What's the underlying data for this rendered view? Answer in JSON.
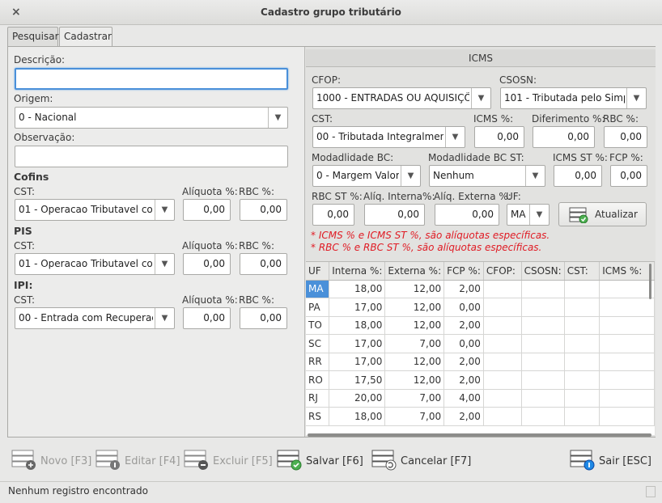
{
  "window": {
    "title": "Cadastro grupo tributário",
    "close_label": "×"
  },
  "tabs": [
    {
      "label": "Pesquisar"
    },
    {
      "label": "Cadastrar"
    }
  ],
  "form": {
    "descricao_label": "Descrição:",
    "descricao_value": "",
    "origem_label": "Origem:",
    "origem_value": "0 - Nacional",
    "observacao_label": "Observação:",
    "observacao_value": "",
    "cofins": {
      "title": "Cofins",
      "cst_label": "CST:",
      "cst_value": "01 - Operacao Tributavel com",
      "aliquota_label": "Alíquota %:",
      "aliquota_value": "0,00",
      "rbc_label": "RBC %:",
      "rbc_value": "0,00"
    },
    "pis": {
      "title": "PIS",
      "cst_label": "CST:",
      "cst_value": "01 - Operacao Tributavel com",
      "aliquota_label": "Alíquota %:",
      "aliquota_value": "0,00",
      "rbc_label": "RBC %:",
      "rbc_value": "0,00"
    },
    "ipi": {
      "title": "IPI:",
      "cst_label": "CST:",
      "cst_value": "00 - Entrada com Recuperaçã",
      "aliquota_label": "Alíquota %:",
      "aliquota_value": "0,00",
      "rbc_label": "RBC %:",
      "rbc_value": "0,00"
    }
  },
  "icms": {
    "title": "ICMS",
    "cfop_label": "CFOP:",
    "cfop_value": "1000 - ENTRADAS OU AQUISIÇÕE",
    "csosn_label": "CSOSN:",
    "csosn_value": "101 - Tributada pelo Simpl",
    "cst_label": "CST:",
    "cst_value": "00 - Tributada Integralmente",
    "icms_label": "ICMS %:",
    "icms_value": "0,00",
    "diferimento_label": "Diferimento %:",
    "diferimento_value": "0,00",
    "rbc_label": "RBC %:",
    "rbc_value": "0,00",
    "modbc_label": "Modadlidade BC:",
    "modbc_value": "0 - Margem Valor",
    "modbcst_label": "Modadlidade BC ST:",
    "modbcst_value": "Nenhum",
    "icmsst_label": "ICMS ST %:",
    "icmsst_value": "0,00",
    "fcp_label": "FCP %:",
    "fcp_value": "0,00",
    "rbcst_label": "RBC ST %:",
    "rbcst_value": "0,00",
    "aliq_interna_label": "Alíq. Interna%:",
    "aliq_interna_value": "0,00",
    "aliq_externa_label": "Alíq. Externa %:",
    "aliq_externa_value": "0,00",
    "uf_label": "UF:",
    "uf_value": "MA",
    "atualizar_label": "Atualizar",
    "note1": "* ICMS % e ICMS ST %, são alíquotas específicas.",
    "note2": "* RBC % e RBC ST %, são alíquotas específicas.",
    "table": {
      "columns": [
        "UF",
        "Interna %:",
        "Externa %:",
        "FCP %:",
        "CFOP:",
        "CSOSN:",
        "CST:",
        "ICMS %:"
      ],
      "rows": [
        [
          "MA",
          "18,00",
          "12,00",
          "2,00",
          "",
          "",
          "",
          ""
        ],
        [
          "PA",
          "17,00",
          "12,00",
          "0,00",
          "",
          "",
          "",
          ""
        ],
        [
          "TO",
          "18,00",
          "12,00",
          "2,00",
          "",
          "",
          "",
          ""
        ],
        [
          "SC",
          "17,00",
          "7,00",
          "0,00",
          "",
          "",
          "",
          ""
        ],
        [
          "RR",
          "17,00",
          "12,00",
          "2,00",
          "",
          "",
          "",
          ""
        ],
        [
          "RO",
          "17,50",
          "12,00",
          "2,00",
          "",
          "",
          "",
          ""
        ],
        [
          "RJ",
          "20,00",
          "7,00",
          "4,00",
          "",
          "",
          "",
          ""
        ],
        [
          "RS",
          "18,00",
          "7,00",
          "2,00",
          "",
          "",
          "",
          ""
        ]
      ]
    }
  },
  "toolbar": {
    "novo": "Novo [F3]",
    "editar": "Editar [F4]",
    "excluir": "Excluir [F5]",
    "salvar": "Salvar [F6]",
    "cancelar": "Cancelar [F7]",
    "sair": "Sair [ESC]"
  },
  "status": {
    "text": "Nenhum registro encontrado"
  },
  "colors": {
    "accent": "#4a90d9",
    "note_red": "#e01b24",
    "ok_green": "#4caf50",
    "info_blue": "#1e88e5"
  }
}
